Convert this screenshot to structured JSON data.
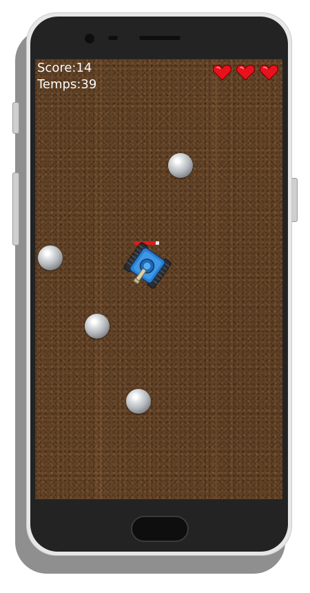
{
  "hud": {
    "score_text": "Score:14",
    "time_text": "Temps:39",
    "lives": 3,
    "heart_icon": "heart-icon",
    "heart_color": "#e8121d"
  },
  "player": {
    "health_fraction": 0.85,
    "health_color": "#e01b1b",
    "tank_color": "#2b7fd1"
  },
  "game": {
    "ball_count": 4,
    "ground": "dirt"
  }
}
